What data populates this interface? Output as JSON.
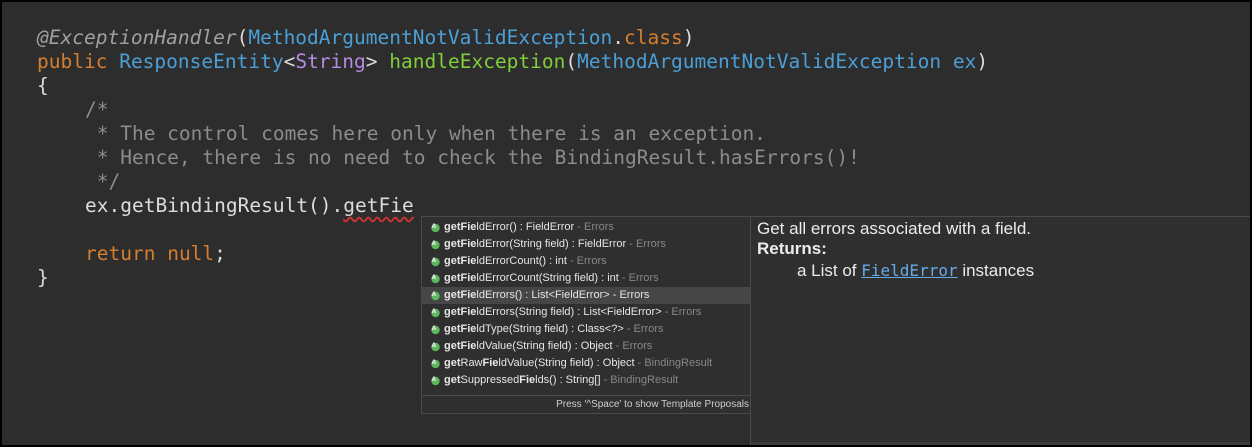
{
  "code": {
    "line1": {
      "annotation": "@ExceptionHandler",
      "open": "(",
      "type": "MethodArgumentNotValidException",
      "dot": ".",
      "class_kw": "class",
      "close": ")"
    },
    "line2": {
      "public_kw": "public",
      "sp1": " ",
      "return_type": "ResponseEntity",
      "lt": "<",
      "generic": "String",
      "gt": ">",
      "sp2": " ",
      "method": "handleException",
      "open": "(",
      "param_type": "MethodArgumentNotValidException",
      "sp3": " ",
      "param": "ex",
      "close": ")"
    },
    "line3": "{",
    "comment1": "/*",
    "comment2": " * The control comes here only when there is an exception.",
    "comment3": " * Hence, there is no need to check the BindingResult.hasErrors()!",
    "comment4": " */",
    "line8": {
      "prefix": "ex.getBindingResult().",
      "typed": "getFie"
    },
    "line10": {
      "return_kw": "return",
      "sp": " ",
      "null_kw": "null",
      "semi": ";"
    },
    "line11": "}"
  },
  "completion": {
    "items": [
      {
        "match": "getFie",
        "rest": "ldError() : FieldError",
        "source": " - Errors",
        "selected": false
      },
      {
        "match": "getFie",
        "rest": "ldError(String field) : FieldError",
        "source": " - Errors",
        "selected": false
      },
      {
        "match": "getFie",
        "rest": "ldErrorCount() : int",
        "source": " - Errors",
        "selected": false
      },
      {
        "match": "getFie",
        "rest": "ldErrorCount(String field) : int",
        "source": " - Errors",
        "selected": false
      },
      {
        "match": "getFie",
        "rest": "ldErrors() : List<FieldError>",
        "source": " - Errors",
        "selected": true
      },
      {
        "match": "getFie",
        "rest": "ldErrors(String field) : List<FieldError>",
        "source": " - Errors",
        "selected": false
      },
      {
        "match": "getFie",
        "rest": "ldType(String field) : Class<?>",
        "source": " - Errors",
        "selected": false
      },
      {
        "match": "getFie",
        "rest": "ldValue(String field) : Object",
        "source": " - Errors",
        "selected": false
      },
      {
        "pre": "get",
        "preMatch": "Raw",
        "match": "Fie",
        "rest": "ldValue(String field) : Object",
        "source": " - BindingResult",
        "selected": false,
        "complex": "raw"
      },
      {
        "pre": "get",
        "preMatch": "Suppressed",
        "match": "Fie",
        "rest": "lds() : String[]",
        "source": " - BindingResult",
        "selected": false,
        "complex": "supp"
      }
    ],
    "footer": "Press '^Space' to show Template Proposals"
  },
  "doc": {
    "description": "Get all errors associated with a field.",
    "returns_label": "Returns:",
    "returns_prefix": "a List of ",
    "returns_link": "FieldError",
    "returns_suffix": " instances"
  },
  "colors": {
    "background": "#2d2d2d",
    "keyword": "#d47f30",
    "type": "#4b9fd6",
    "method": "#7fce3c",
    "comment": "#8c8c8c",
    "link": "#6aa9e8"
  },
  "icons": {
    "method_item": "public-method-icon"
  }
}
